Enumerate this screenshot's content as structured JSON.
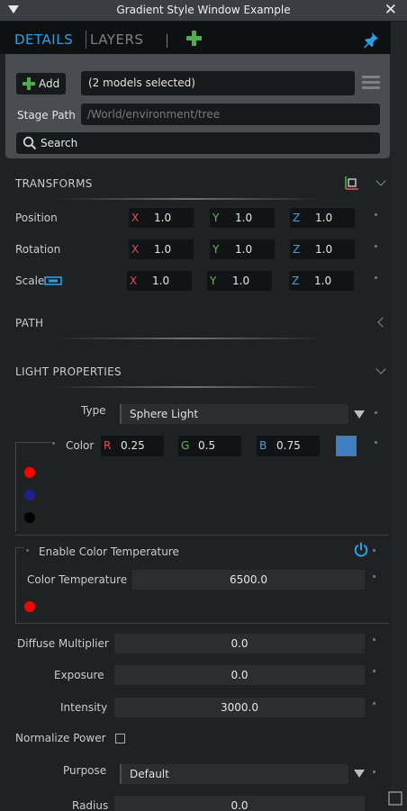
{
  "window": {
    "title": "Gradient Style Window Example",
    "close_glyph": "✕"
  },
  "tabs": {
    "details": "DETAILS",
    "layers": "LAYERS"
  },
  "header": {
    "add_label": "Add",
    "selection": "(2 models selected)",
    "stage_path_label": "Stage Path",
    "stage_path_value": "/World/environment/tree",
    "search_label": "Search"
  },
  "transforms": {
    "title": "TRANSFORMS",
    "rows": [
      {
        "label": "Position",
        "x": "1.0",
        "y": "1.0",
        "z": "1.0"
      },
      {
        "label": "Rotation",
        "x": "1.0",
        "y": "1.0",
        "z": "1.0"
      },
      {
        "label": "Scale",
        "x": "1.0",
        "y": "1.0",
        "z": "1.0"
      }
    ],
    "axis": {
      "x": "X",
      "y": "Y",
      "z": "Z"
    }
  },
  "path": {
    "title": "PATH"
  },
  "light": {
    "title": "LIGHT PROPERTIES",
    "type_label": "Type",
    "type_value": "Sphere Light",
    "color_label": "Color",
    "color_r_label": "R",
    "color_r": "0.25",
    "color_g_label": "G",
    "color_g": "0.5",
    "color_b_label": "B",
    "color_b": "0.75",
    "color_swatch": "#3f7fbf",
    "enable_temp_label": "Enable Color Temperature",
    "temp_label": "Color Temperature",
    "temp_value": "6500.0",
    "diffuse_label": "Diffuse Multiplier",
    "diffuse_value": "0.0",
    "exposure_label": "Exposure",
    "exposure_value": "0.0",
    "intensity_label": "Intensity",
    "intensity_value": "3000.0",
    "normalize_label": "Normalize Power",
    "purpose_label": "Purpose",
    "purpose_value": "Default",
    "radius_label": "Radius",
    "radius_value": "0.0"
  },
  "colors": {
    "accent": "#2aa0e6",
    "green": "#4cae4f",
    "red": "#e3515a"
  }
}
